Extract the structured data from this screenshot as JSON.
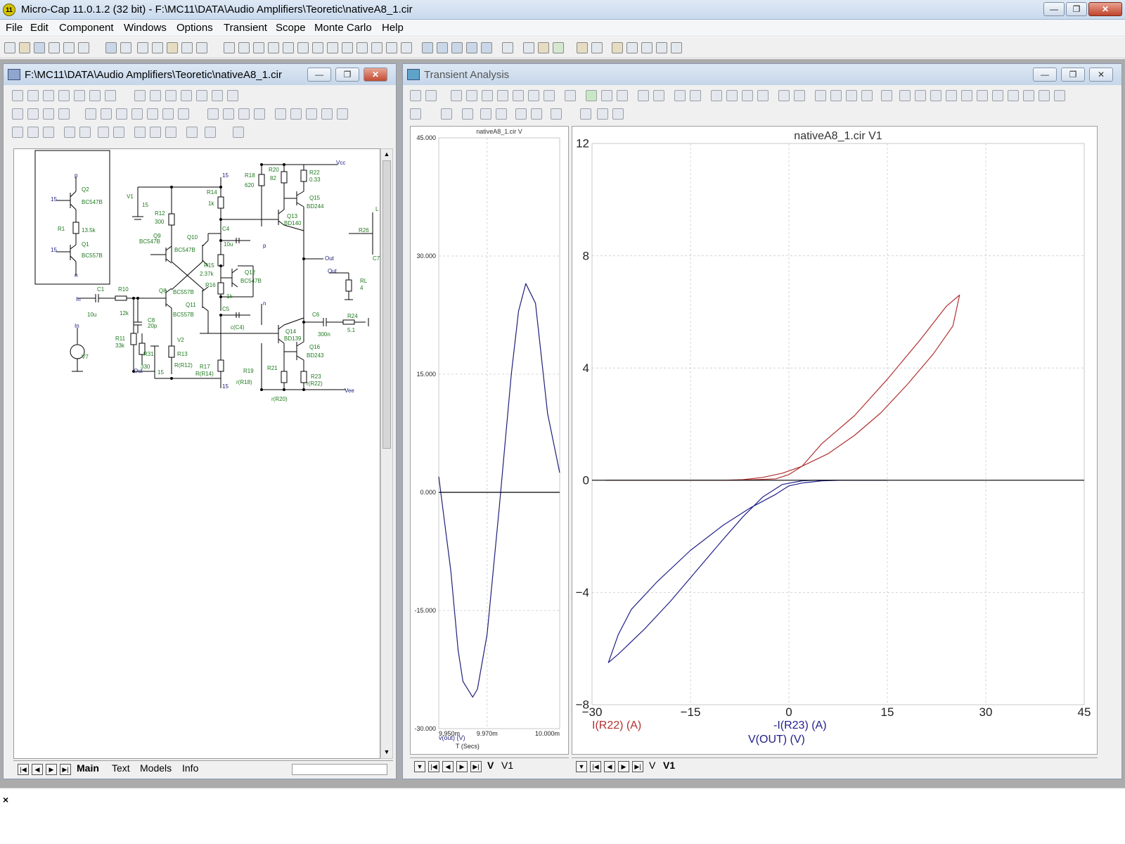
{
  "app": {
    "title": "Micro-Cap 11.0.1.2 (32 bit) - F:\\MC11\\DATA\\Audio Amplifiers\\Teoretic\\nativeA8_1.cir",
    "icon_name": "micro-cap-logo-icon",
    "icon_text": "11"
  },
  "menu": [
    "File",
    "Edit",
    "Component",
    "Windows",
    "Options",
    "Transient",
    "Scope",
    "Monte Carlo",
    "Help"
  ],
  "schematic_window": {
    "title": "F:\\MC11\\DATA\\Audio Amplifiers\\Teoretic\\nativeA8_1.cir",
    "tabs": [
      "Main",
      "Text",
      "Models",
      "Info"
    ],
    "active_tab": "Main",
    "component_color": "#1e7a1e",
    "wire_color": "#000000",
    "labels": {
      "q2": "Q2",
      "q2m": "BC547B",
      "r1": "R1",
      "r1v": "13.5k",
      "q1": "Q1",
      "q1m": "BC557B",
      "n15a": "15",
      "n15b": "15",
      "np": "p",
      "nn": "n",
      "v1": "V1",
      "v1v": "15",
      "r12": "R12",
      "r12v": "300",
      "r14": "R14",
      "r14v": "1k",
      "r18": "R18",
      "r18v": "620",
      "r20": "R20",
      "r20v": "82",
      "r22": "R22",
      "r22v": "0.33",
      "q15": "Q15",
      "q15m": "BD244",
      "q13": "Q13",
      "q13m": "BD140",
      "c4": "C4",
      "c4v": "10u",
      "q9": "Q9",
      "q9m": "BC547B",
      "q10": "Q10",
      "q10m": "BC547B",
      "r15": "R15",
      "r15v": "2.37k",
      "q12": "Q12",
      "q12m": "BC547B",
      "r16": "R16",
      "r16v": "1k",
      "c1": "C1",
      "c1v": "10u",
      "r10": "R10",
      "r10v": "12k",
      "q8": "Q8",
      "q8m": "BC557B",
      "q11": "Q11",
      "q11m": "BC557B",
      "c5": "C5",
      "c5v": "c(C4)",
      "c8": "C8",
      "c8v": "20p",
      "r11": "R11",
      "r11v": "33k",
      "r31": "R31",
      "r31v": "330",
      "v2": "V2",
      "v2v": "15",
      "r13": "R13",
      "r13v": "R(R12)",
      "r17": "R17",
      "r17v": "R(R14)",
      "r19": "R19",
      "r19v": "r(R18)",
      "r21": "R21",
      "r21v": "r(R20)",
      "q14": "Q14",
      "q14m": "BD139",
      "q16": "Q16",
      "q16m": "BD243",
      "r23": "R23",
      "r23v": "r(R22)",
      "c6": "C6",
      "c6v": "300n",
      "r24": "R24",
      "r24v": "5.1",
      "rl": "RL",
      "rlv": "4",
      "out": "Out",
      "vcc": "Vcc",
      "vee": "Vee",
      "v7": "V7",
      "r26": "R26",
      "l": "L",
      "c7": "C7",
      "nin": "In",
      "nout": "Out"
    }
  },
  "transient_window": {
    "title": "Transient Analysis",
    "left_tabs": [
      "V",
      "V1"
    ],
    "left_active": "V",
    "right_tabs": [
      "V",
      "V1"
    ],
    "right_active": "V1"
  },
  "chart_data": [
    {
      "type": "line",
      "title": "nativeA8_1.cir V",
      "xlabel": "T (Secs)",
      "xlim": [
        0.00995,
        0.01
      ],
      "ylim": [
        -30,
        45
      ],
      "x_ticks": [
        "9.950m",
        "9.970m",
        "10.000m"
      ],
      "y_ticks": [
        "45.000",
        "30.000",
        "15.000",
        "0.000",
        "-15.000",
        "-30.000"
      ],
      "grid": true,
      "legend": "bottom-left",
      "series": [
        {
          "name": "v(out) (V)",
          "color": "#1f1f7a",
          "x": [
            0.00995,
            0.009955,
            0.009958,
            0.00996,
            0.009964,
            0.009966,
            0.00997,
            0.009975,
            0.00998,
            0.009983,
            0.009986,
            0.00999,
            0.009995,
            0.01
          ],
          "values": [
            2,
            -10,
            -20,
            -24,
            -26,
            -25,
            -18,
            -2,
            15,
            23,
            26.5,
            24,
            10,
            2.5
          ]
        },
        {
          "name": "",
          "color": "#000000",
          "x": [
            0.00995,
            0.01
          ],
          "values": [
            0,
            0
          ]
        }
      ]
    },
    {
      "type": "line",
      "title": "nativeA8_1.cir V1",
      "xlim": [
        -30,
        45
      ],
      "ylim": [
        -8,
        12
      ],
      "x_ticks": [
        -30,
        -15,
        0,
        15,
        30,
        45
      ],
      "y_ticks": [
        12,
        8,
        4,
        0,
        -4,
        -8
      ],
      "grid": true,
      "legend": "bottom-left",
      "axis_labels_printed": [
        "V(OUT) (V)"
      ],
      "series": [
        {
          "name": "I(R22) (A)",
          "color": "#b03030",
          "x": [
            -28,
            -10,
            -7,
            -4,
            -1,
            2,
            6,
            10,
            14,
            18,
            22,
            25,
            26,
            24,
            20,
            15,
            10,
            5,
            2,
            0,
            -2,
            -6,
            -10,
            -28
          ],
          "values": [
            0,
            0,
            0.02,
            0.1,
            0.25,
            0.5,
            0.95,
            1.6,
            2.4,
            3.4,
            4.5,
            5.5,
            6.6,
            6.2,
            5.0,
            3.6,
            2.3,
            1.3,
            0.5,
            0.2,
            0.05,
            0.01,
            0,
            0
          ]
        },
        {
          "name": "-I(R23) (A)",
          "color": "#20208a",
          "x": [
            15,
            8,
            5,
            2,
            0,
            -2,
            -6,
            -10,
            -15,
            -20,
            -24,
            -26,
            -27.5,
            -26,
            -22,
            -18,
            -14,
            -10,
            -7,
            -4,
            -1,
            2,
            4,
            15
          ],
          "values": [
            0,
            0,
            -0.02,
            -0.1,
            -0.2,
            -0.5,
            -1.0,
            -1.6,
            -2.5,
            -3.6,
            -4.6,
            -5.5,
            -6.5,
            -6.2,
            -5.3,
            -4.3,
            -3.2,
            -2.1,
            -1.3,
            -0.6,
            -0.15,
            -0.02,
            0,
            0
          ]
        },
        {
          "name": "",
          "color": "#000000",
          "x": [
            -30,
            45
          ],
          "values": [
            0,
            0
          ]
        }
      ]
    }
  ]
}
